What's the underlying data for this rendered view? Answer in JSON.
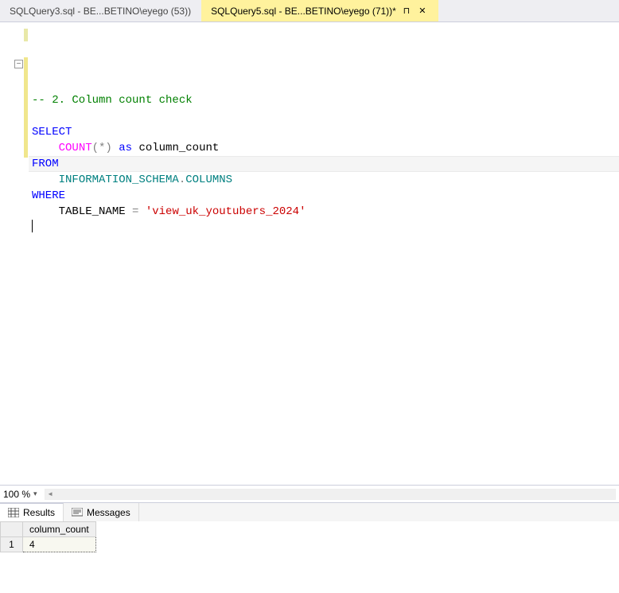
{
  "tabs": [
    {
      "label": "SQLQuery3.sql - BE...BETINO\\eyego (53))",
      "active": false
    },
    {
      "label": "SQLQuery5.sql - BE...BETINO\\eyego (71))*",
      "active": true
    }
  ],
  "icons": {
    "pin": "⊓",
    "close": "✕",
    "outline_collapse": "−",
    "dropdown": "▾",
    "scroll_left": "◄"
  },
  "code": {
    "comment": "-- 2. Column count check",
    "kw_select": "SELECT",
    "func_count": "COUNT",
    "grey_paren_star": "(*)",
    "kw_as": " as ",
    "alias": "column_count",
    "kw_from": "FROM",
    "ident_schema": "INFORMATION_SCHEMA",
    "dot": ".",
    "ident_columns": "COLUMNS",
    "kw_where": "WHERE",
    "field_table_name": "TABLE_NAME",
    "eq": " = ",
    "string_lit": "'view_uk_youtubers_2024'"
  },
  "zoom": {
    "value": "100 %"
  },
  "results_tabs": {
    "results_label": "Results",
    "messages_label": "Messages"
  },
  "grid": {
    "columns": [
      "column_count"
    ],
    "rows": [
      {
        "n": "1",
        "values": [
          "4"
        ]
      }
    ]
  }
}
